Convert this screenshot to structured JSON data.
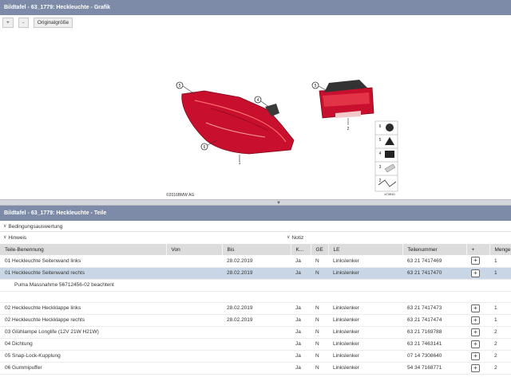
{
  "graphic_panel": {
    "title": "Bildtafel - 63_1779: Heckleuchte - Grafik",
    "zoom_in_label": "+",
    "zoom_out_label": "-",
    "original_size_label": "Originalgröße",
    "copyright": "©2016BMW AG",
    "image_number": "473910",
    "callouts": [
      "5",
      "4",
      "6",
      "1",
      "5",
      "2"
    ],
    "small_parts": [
      "6",
      "5",
      "4",
      "3",
      "2"
    ]
  },
  "parts_panel": {
    "title": "Bildtafel - 63_1779: Heckleuchte - Teile",
    "conditions_label": "Bedingungsauswertung",
    "hint_label": "Hinweis",
    "note_label": "Notiz",
    "columns": [
      "Teile-Benennung",
      "Von",
      "Bis",
      "K...",
      "GE",
      "LE",
      "Teilenummer",
      "+",
      "Menge"
    ],
    "rows": [
      {
        "name": "01 Heckleuchte Seitenwand links",
        "from": "",
        "to": "28.02.2019",
        "k": "Ja",
        "ge": "N",
        "le": "Linkslenker",
        "part_no": "63 21 7417469",
        "add": "+",
        "qty": "1",
        "selected": false
      },
      {
        "name": "01 Heckleuchte Seitenwand rechts",
        "from": "",
        "to": "28.02.2019",
        "k": "Ja",
        "ge": "N",
        "le": "Linkslenker",
        "part_no": "63 21 7417470",
        "add": "+",
        "qty": "1",
        "selected": true
      },
      {
        "name": "02 Heckleuchte Heckklappe links",
        "from": "",
        "to": "28.02.2019",
        "k": "Ja",
        "ge": "N",
        "le": "Linkslenker",
        "part_no": "63 21 7417473",
        "add": "+",
        "qty": "1",
        "selected": false
      },
      {
        "name": "02 Heckleuchte Heckklappe rechts",
        "from": "",
        "to": "28.02.2019",
        "k": "Ja",
        "ge": "N",
        "le": "Linkslenker",
        "part_no": "63 21 7417474",
        "add": "+",
        "qty": "1",
        "selected": false
      },
      {
        "name": "03 Glühlampe Longlife (12V 21W H21W)",
        "from": "",
        "to": "",
        "k": "Ja",
        "ge": "N",
        "le": "Linkslenker",
        "part_no": "63 21 7169788",
        "add": "+",
        "qty": "2",
        "selected": false
      },
      {
        "name": "04 Dichtung",
        "from": "",
        "to": "",
        "k": "Ja",
        "ge": "N",
        "le": "Linkslenker",
        "part_no": "63 21 7463141",
        "add": "+",
        "qty": "2",
        "selected": false
      },
      {
        "name": "05 Snap-Lock-Kupplung",
        "from": "",
        "to": "",
        "k": "Ja",
        "ge": "N",
        "le": "Linkslenker",
        "part_no": "07 14 7308640",
        "add": "+",
        "qty": "2",
        "selected": false
      },
      {
        "name": "06 Gummipuffer",
        "from": "",
        "to": "",
        "k": "Ja",
        "ge": "N",
        "le": "Linkslenker",
        "part_no": "54 34 7168771",
        "add": "+",
        "qty": "2",
        "selected": false
      }
    ],
    "inline_note": "Puma Massnahme 56712456-02 beachtent"
  },
  "colors": {
    "title_bar": "#7d8aa8",
    "selected_row": "#c9d6e6",
    "header_row": "#dcdcdc",
    "lamp_red": "#c8102e"
  }
}
